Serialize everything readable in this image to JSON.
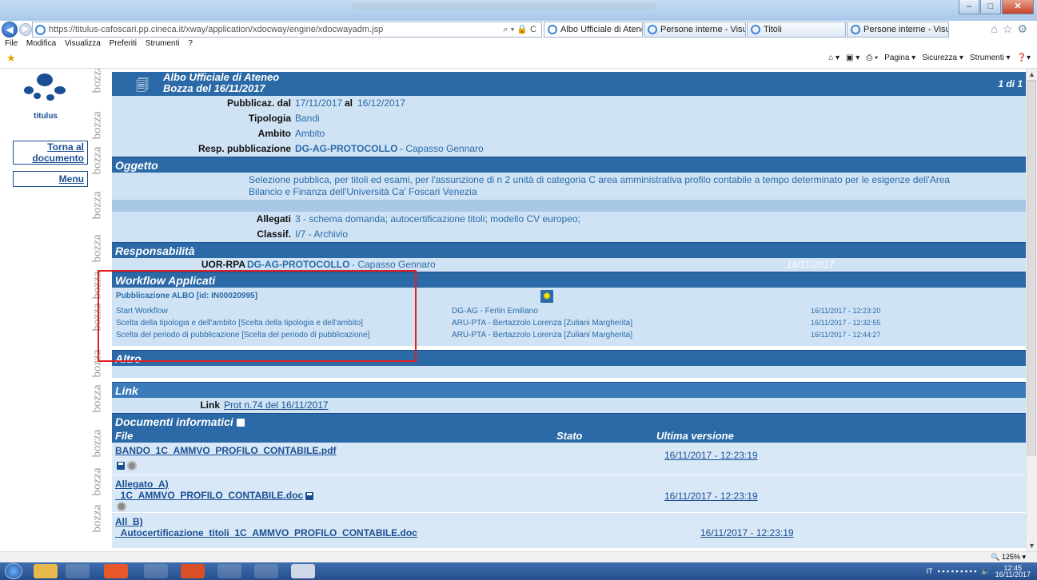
{
  "browser": {
    "address": "https://titulus-cafoscari.pp.cineca.it/xway/application/xdocway/engine/xdocwayadm.jsp",
    "address_tools": "⌕ ▾ 🔒 C",
    "tabs": [
      {
        "label": "Albo Ufficiale di Ateneo: Sel...",
        "active": true
      },
      {
        "label": "Persone interne - Visualizzazio...",
        "active": false
      },
      {
        "label": "Titoli",
        "active": false
      },
      {
        "label": "Persone interne - Visualizzazio...",
        "active": false
      }
    ],
    "menu": [
      "File",
      "Modifica",
      "Visualizza",
      "Preferiti",
      "Strumenti",
      "?"
    ],
    "command_bar": [
      "Pagina ▾",
      "Sicurezza ▾",
      "Strumenti ▾"
    ],
    "zoom": "125%"
  },
  "sidebar": {
    "logo_text": "titulus",
    "back_button": "Torna al documento",
    "menu_button": "Menu",
    "watermark": "bozza"
  },
  "doc": {
    "title": "Albo Ufficiale di Ateneo",
    "subtitle": "Bozza del 16/11/2017",
    "page_count": "1 di 1",
    "pubblicaz_label": "Pubblicaz. dal",
    "pubblicaz_from": "17/11/2017",
    "pubblicaz_al_label": "al",
    "pubblicaz_to": "16/12/2017",
    "tipologia_label": "Tipologia",
    "tipologia": "Bandi",
    "ambito_label": "Ambito",
    "ambito": "Ambito",
    "resp_label": "Resp. pubblicazione",
    "resp_office": "DG-AG-PROTOCOLLO",
    "resp_person": "-  Capasso Gennaro",
    "oggetto_header": "Oggetto",
    "oggetto_line1": "Selezione pubblica, per titoli ed esami, per l'assunzione di n 2 unità di categoria C area amministrativa profilo contabile a tempo determinato per le esigenze dell'Area",
    "oggetto_line2": "Bilancio e Finanza dell'Università Ca' Foscari Venezia",
    "allegati_label": "Allegati",
    "allegati": "3 -  schema domanda; autocertificazione titoli; modello CV europeo;",
    "classif_label": "Classif.",
    "classif": "I/7 - Archivio",
    "resp_header": "Responsabilità",
    "uor_label": "UOR-RPA",
    "uor_office": "DG-AG-PROTOCOLLO",
    "uor_person": "- Capasso Gennaro",
    "uor_date": "16/11/2017",
    "workflow_header": "Workflow Applicati",
    "workflow_title": "Pubblicazione ALBO [id: IN00020995]",
    "workflow_steps": [
      {
        "step": "Start Workflow",
        "user": "DG-AG - Ferlin Emiliano",
        "date": "16/11/2017  -  12:23:20"
      },
      {
        "step": "Scelta della tipologia e dell'ambito [Scelta della tipologia e dell'ambito]",
        "user": "ARU-PTA - Bertazzolo Lorenza [Zuliani Margherita]",
        "date": "16/11/2017  -  12:32:55"
      },
      {
        "step": "Scelta del periodo di pubblicazione [Scelta del periodo di pubblicazione]",
        "user": "ARU-PTA - Bertazzolo Lorenza [Zuliani Margherita]",
        "date": "16/11/2017  -  12:44:27"
      }
    ],
    "altro_header": "Altro",
    "link_header": "Link",
    "link_label": "Link",
    "link_value": "Prot n.74 del 16/11/2017",
    "docinfo_header": "Documenti informatici",
    "col_file": "File",
    "col_stato": "Stato",
    "col_ultima": "Ultima versione",
    "files": [
      {
        "name": "BANDO_1C_AMMVO_PROFILO_CONTABILE.pdf",
        "prefix": "",
        "date": "16/11/2017 - 12:23:19"
      },
      {
        "name": "_1C_AMMVO_PROFILO_CONTABILE.doc",
        "prefix": "Allegato_A)",
        "date": "16/11/2017 - 12:23:19"
      },
      {
        "name": "_Autocertificazione_titoli_1C_AMMVO_PROFILO_CONTABILE.doc",
        "prefix": "All_B)",
        "date": "16/11/2017 - 12:23:19"
      }
    ]
  },
  "taskbar": {
    "lang": "IT",
    "time": "12:45",
    "date": "16/11/2017"
  }
}
